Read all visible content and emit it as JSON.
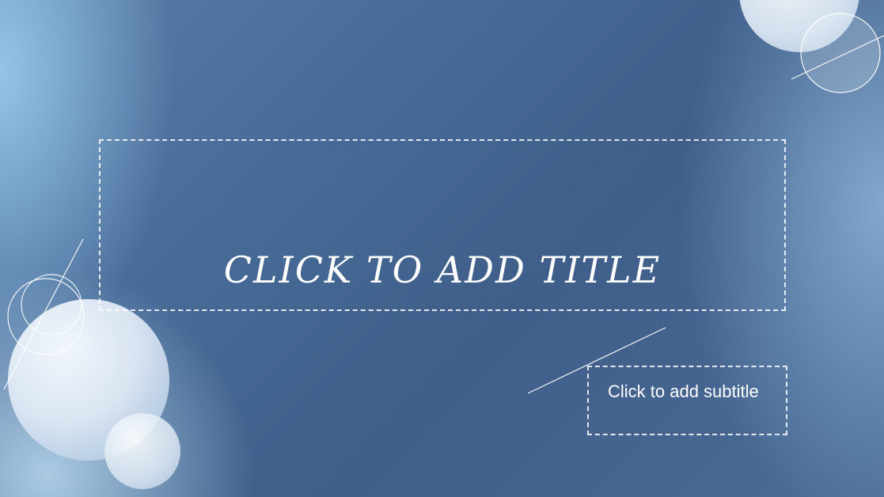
{
  "slide": {
    "title_placeholder": "CLICK TO ADD TITLE",
    "subtitle_placeholder": "Click to add subtitle"
  },
  "colors": {
    "background": "#41628e",
    "text": "#ffffff",
    "bubble": "#dde8f4"
  }
}
